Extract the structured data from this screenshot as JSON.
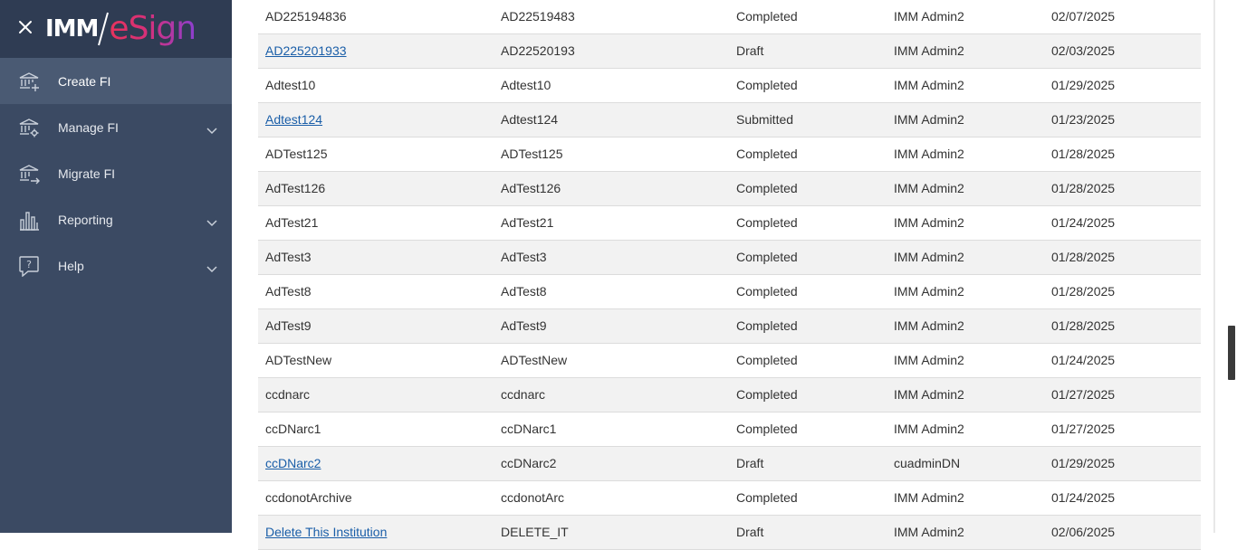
{
  "app": {
    "logo_left": "IMM",
    "logo_right": "eSign"
  },
  "sidebar": {
    "items": [
      {
        "label": "Create FI",
        "icon": "bank-add-icon",
        "has_chevron": false,
        "active": true
      },
      {
        "label": "Manage FI",
        "icon": "bank-gear-icon",
        "has_chevron": true,
        "active": false
      },
      {
        "label": "Migrate FI",
        "icon": "bank-arrow-icon",
        "has_chevron": false,
        "active": false
      },
      {
        "label": "Reporting",
        "icon": "bar-chart-icon",
        "has_chevron": true,
        "active": false
      },
      {
        "label": "Help",
        "icon": "help-bubble-icon",
        "has_chevron": true,
        "active": false
      }
    ]
  },
  "table": {
    "rows": [
      {
        "name": "AD225194836",
        "code": "AD22519483",
        "status": "Completed",
        "user": "IMM Admin2",
        "date": "02/07/2025",
        "link": false
      },
      {
        "name": "AD225201933",
        "code": "AD22520193",
        "status": "Draft",
        "user": "IMM Admin2",
        "date": "02/03/2025",
        "link": true
      },
      {
        "name": "Adtest10",
        "code": "Adtest10",
        "status": "Completed",
        "user": "IMM Admin2",
        "date": "01/29/2025",
        "link": false
      },
      {
        "name": "Adtest124",
        "code": "Adtest124",
        "status": "Submitted",
        "user": "IMM Admin2",
        "date": "01/23/2025",
        "link": true
      },
      {
        "name": "ADTest125",
        "code": "ADTest125",
        "status": "Completed",
        "user": "IMM Admin2",
        "date": "01/28/2025",
        "link": false
      },
      {
        "name": "AdTest126",
        "code": "AdTest126",
        "status": "Completed",
        "user": "IMM Admin2",
        "date": "01/28/2025",
        "link": false
      },
      {
        "name": "AdTest21",
        "code": "AdTest21",
        "status": "Completed",
        "user": "IMM Admin2",
        "date": "01/24/2025",
        "link": false
      },
      {
        "name": "AdTest3",
        "code": "AdTest3",
        "status": "Completed",
        "user": "IMM Admin2",
        "date": "01/28/2025",
        "link": false
      },
      {
        "name": "AdTest8",
        "code": "AdTest8",
        "status": "Completed",
        "user": "IMM Admin2",
        "date": "01/28/2025",
        "link": false
      },
      {
        "name": "AdTest9",
        "code": "AdTest9",
        "status": "Completed",
        "user": "IMM Admin2",
        "date": "01/28/2025",
        "link": false
      },
      {
        "name": "ADTestNew",
        "code": "ADTestNew",
        "status": "Completed",
        "user": "IMM Admin2",
        "date": "01/24/2025",
        "link": false
      },
      {
        "name": "ccdnarc",
        "code": "ccdnarc",
        "status": "Completed",
        "user": "IMM Admin2",
        "date": "01/27/2025",
        "link": false
      },
      {
        "name": "ccDNarc1",
        "code": "ccDNarc1",
        "status": "Completed",
        "user": "IMM Admin2",
        "date": "01/27/2025",
        "link": false
      },
      {
        "name": "ccDNarc2",
        "code": "ccDNarc2",
        "status": "Draft",
        "user": "cuadminDN",
        "date": "01/29/2025",
        "link": true
      },
      {
        "name": "ccdonotArchive",
        "code": "ccdonotArc",
        "status": "Completed",
        "user": "IMM Admin2",
        "date": "01/24/2025",
        "link": false
      },
      {
        "name": "Delete This Institution",
        "code": "DELETE_IT",
        "status": "Draft",
        "user": "IMM Admin2",
        "date": "02/06/2025",
        "link": true
      }
    ]
  },
  "colors": {
    "sidebar_bg": "#3b4a63",
    "brand_bg": "#2f3c53",
    "active_bg": "#4a5a73",
    "link": "#1a5ea8",
    "row_alt": "#f2f2f2"
  }
}
